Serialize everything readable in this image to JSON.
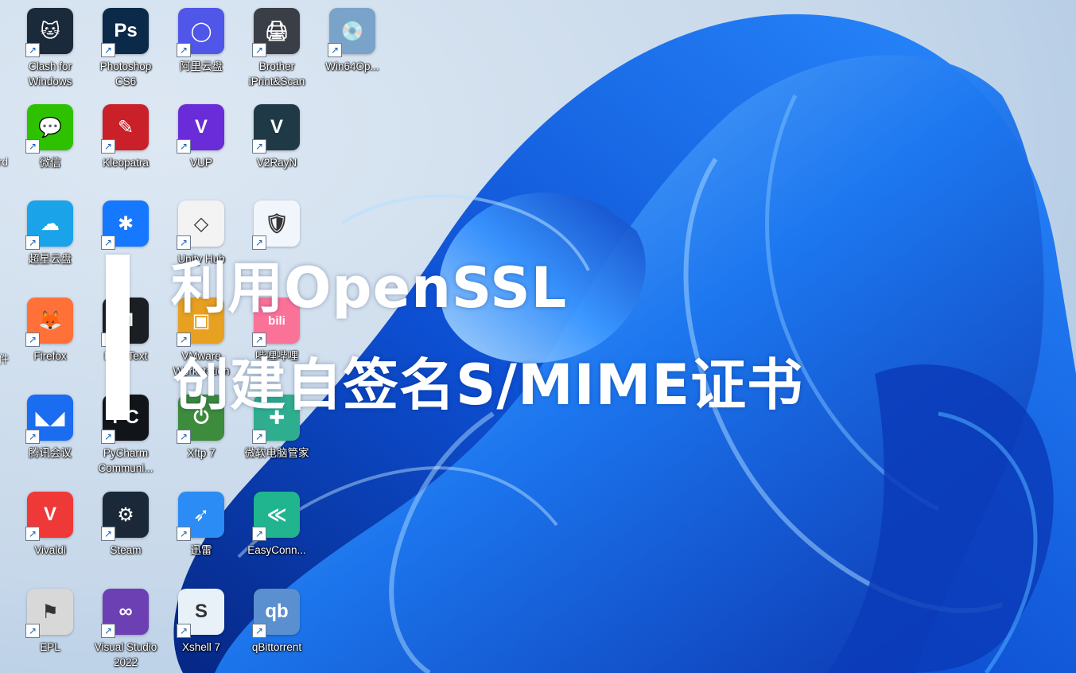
{
  "wallpaper": {
    "name": "windows-11-bloom",
    "accent": "#1a6be8",
    "background": "#c9d9ea"
  },
  "overlay": {
    "title_line1": "利用OpenSSL",
    "title_line2": "创建自签名S/MIME证书"
  },
  "edge_labels": [
    "rd",
    "件"
  ],
  "desktop_icons": [
    {
      "label": "Clash for Windows",
      "icon": "cat-icon",
      "color": "#1b2a3a",
      "glyph": "🐱"
    },
    {
      "label": "Photoshop CS6",
      "icon": "photoshop-icon",
      "color": "#0b2a4a",
      "glyph": "Ps"
    },
    {
      "label": "阿里云盘",
      "icon": "aliyun-drive-icon",
      "color": "#4f56e8",
      "glyph": "◯"
    },
    {
      "label": "Brother iPrint&Scan",
      "icon": "printer-icon",
      "color": "#3a3f47",
      "glyph": "🖨"
    },
    {
      "label": "Win64Op...",
      "icon": "installer-icon",
      "color": "#7aa3c9",
      "glyph": "💿"
    },
    {
      "label": "微信",
      "icon": "wechat-icon",
      "color": "#2dc100",
      "glyph": "💬"
    },
    {
      "label": "Kleopatra",
      "icon": "kleopatra-icon",
      "color": "#c9202a",
      "glyph": "✎"
    },
    {
      "label": "VUP",
      "icon": "vup-icon",
      "color": "#6a2bd8",
      "glyph": "V"
    },
    {
      "label": "V2RayN",
      "icon": "v2rayn-icon",
      "color": "#1f3a46",
      "glyph": "V"
    },
    {
      "label": "超星云盘",
      "icon": "cloud-drive-icon",
      "color": "#1aa3e8",
      "glyph": "☁"
    },
    {
      "label": "",
      "icon": "chat-star-icon",
      "color": "#1677ff",
      "glyph": "✱"
    },
    {
      "label": "Unity Hub",
      "icon": "unity-icon",
      "color": "#f3f3f3",
      "glyph": "◇"
    },
    {
      "label": "",
      "icon": "security-shield-icon",
      "color": "#f0f6fb",
      "glyph": "🛡"
    },
    {
      "label": "Firefox",
      "icon": "firefox-icon",
      "color": "#ff7139",
      "glyph": "🦊"
    },
    {
      "label": "MarkText",
      "icon": "marktext-icon",
      "color": "#1b1f24",
      "glyph": "M"
    },
    {
      "label": "VMware Workstation",
      "icon": "vmware-icon",
      "color": "#e8a020",
      "glyph": "▣"
    },
    {
      "label": "哔哩哔哩",
      "icon": "bilibili-icon",
      "color": "#fb7299",
      "glyph": "bili"
    },
    {
      "label": "腾讯会议",
      "icon": "tencent-meeting-icon",
      "color": "#1a6cf0",
      "glyph": "◣◢"
    },
    {
      "label": "PyCharm Communi...",
      "icon": "pycharm-icon",
      "color": "#111418",
      "glyph": "PC"
    },
    {
      "label": "Xftp 7",
      "icon": "xftp-icon",
      "color": "#3d8b3d",
      "glyph": "⏻"
    },
    {
      "label": "微软电脑管家",
      "icon": "pc-manager-icon",
      "color": "#2fae8f",
      "glyph": "✚"
    },
    {
      "label": "Vivaldi",
      "icon": "vivaldi-icon",
      "color": "#ef3939",
      "glyph": "V"
    },
    {
      "label": "Steam",
      "icon": "steam-icon",
      "color": "#1b2838",
      "glyph": "⚙"
    },
    {
      "label": "迅雷",
      "icon": "thunder-icon",
      "color": "#2a8cf4",
      "glyph": "➶"
    },
    {
      "label": "EasyConn...",
      "icon": "easyconnect-icon",
      "color": "#20b58f",
      "glyph": "≪"
    },
    {
      "label": "EPL",
      "icon": "epl-icon",
      "color": "#d8d8d8",
      "glyph": "⚑"
    },
    {
      "label": "Visual Studio 2022",
      "icon": "visual-studio-icon",
      "color": "#6c3fb3",
      "glyph": "∞"
    },
    {
      "label": "Xshell 7",
      "icon": "xshell-icon",
      "color": "#e8f0f8",
      "glyph": "S"
    },
    {
      "label": "qBittorrent",
      "icon": "qbittorrent-icon",
      "color": "#5a8fd0",
      "glyph": "qb"
    }
  ]
}
